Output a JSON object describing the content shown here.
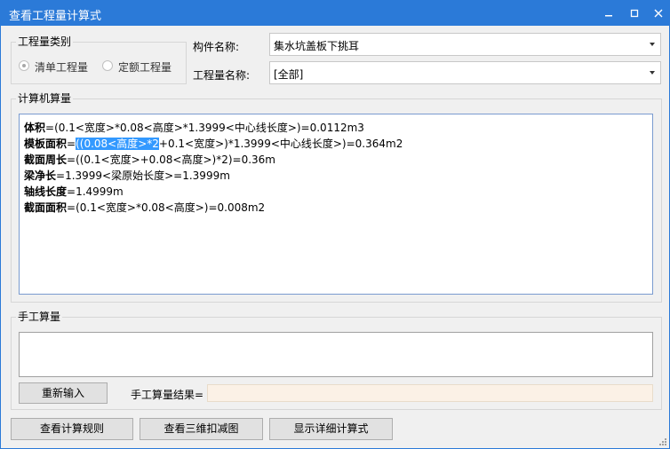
{
  "window": {
    "title": "查看工程量计算式"
  },
  "category_group": {
    "label": "工程量类别",
    "options": [
      {
        "label": "清单工程量",
        "selected": true
      },
      {
        "label": "定额工程量",
        "selected": false
      }
    ]
  },
  "component": {
    "label": "构件名称:",
    "value": "集水坑盖板下挑耳"
  },
  "quantity": {
    "label": "工程量名称:",
    "value": "[全部]"
  },
  "computer_calc": {
    "label": "计算机算量",
    "lines": [
      {
        "name": "体积",
        "formula": "=(0.1<宽度>*0.08<高度>*1.3999<中心线长度>)=0.0112m3"
      },
      {
        "name": "模板面积",
        "formula_selected": "((0.08<高度>*2",
        "formula_rest": "+0.1<宽度>)*1.3999<中心线长度>)=0.364m2"
      },
      {
        "name": "截面周长",
        "formula": "=((0.1<宽度>+0.08<高度>)*2)=0.36m"
      },
      {
        "name": "梁净长",
        "formula": "=1.3999<梁原始长度>=1.3999m"
      },
      {
        "name": "轴线长度",
        "formula": "=1.4999m"
      },
      {
        "name": "截面面积",
        "formula": "=(0.1<宽度>*0.08<高度>)=0.008m2"
      }
    ]
  },
  "manual_calc": {
    "label": "手工算量",
    "reenter_button": "重新输入",
    "result_label": "手工算量结果=",
    "result_value": ""
  },
  "footer": {
    "rules_button": "查看计算规则",
    "view3d_button": "查看三维扣减图",
    "detail_button": "显示详细计算式"
  },
  "icons": [
    "minimize-icon",
    "maximize-icon",
    "close-icon",
    "dropdown-arrow-icon",
    "resize-grip-icon"
  ],
  "colors": {
    "titlebar": "#2b7ad8",
    "selection": "#3399ff",
    "result_field": "#fbf1e6"
  }
}
